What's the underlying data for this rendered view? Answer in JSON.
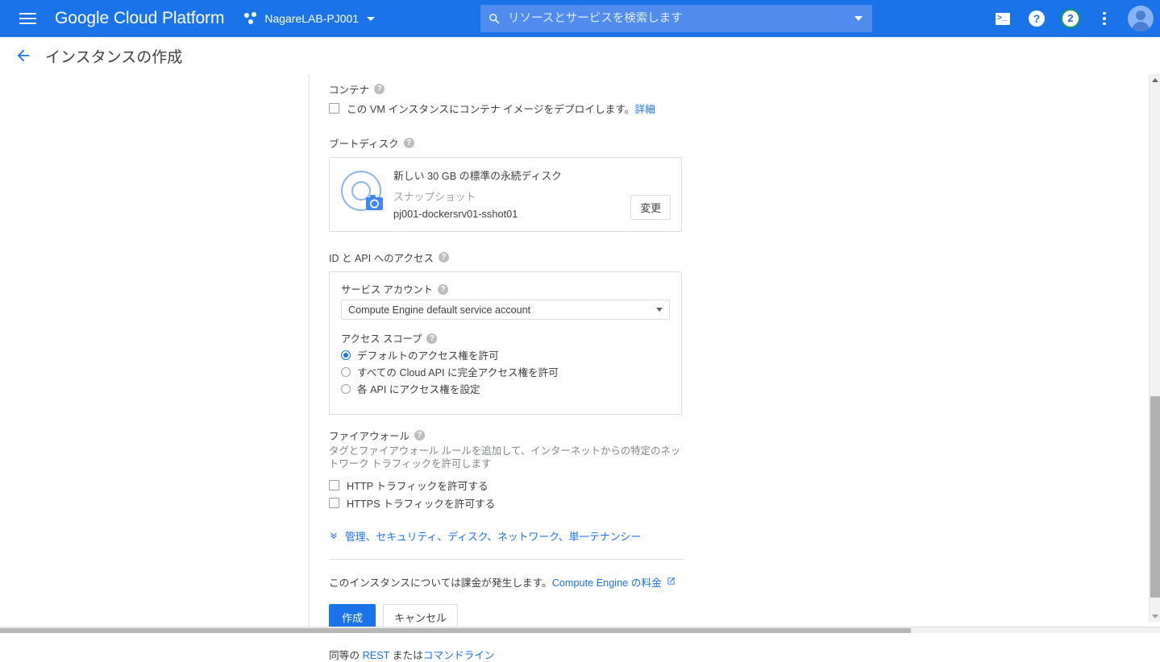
{
  "header": {
    "menu_icon": "hamburger-menu-icon",
    "brand": "Google Cloud Platform",
    "project": {
      "icon": "project-dots-icon",
      "name": "NagareLAB-PJ001",
      "caret": "chevron-down-icon"
    },
    "search": {
      "icon": "search-icon",
      "placeholder": "リソースとサービスを検索します",
      "value": "",
      "caret": "chevron-down-icon"
    },
    "actions": {
      "cloud_shell": ">_",
      "help": "?",
      "notifications_count": "2",
      "more_icon": "vertical-dots-icon",
      "avatar": "user-avatar"
    },
    "colors": {
      "header_blue": "#1a73e8",
      "search_blue": "#4f8ced",
      "notification_ring_green": "#0f9d58",
      "link_blue": "#1a73e8"
    }
  },
  "subheader": {
    "back_icon": "arrow-left-icon",
    "title": "インスタンスの作成"
  },
  "form": {
    "container": {
      "label": "コンテナ",
      "help": "?",
      "checkbox_label": "この VM インスタンスにコンテナ イメージをデプロイします。",
      "checkbox_checked": false,
      "detail_link": "詳細"
    },
    "boot_disk": {
      "label": "ブートディスク",
      "help": "?",
      "icon": "disk-snapshot-icon",
      "summary": "新しい 30 GB の標準の永続ディスク",
      "source_type": "スナップショット",
      "source_name": "pj001-dockersrv01-sshot01",
      "change_button": "変更"
    },
    "id_api": {
      "label": "ID と API へのアクセス",
      "help": "?",
      "service_account": {
        "label": "サービス アカウント",
        "help": "?",
        "value": "Compute Engine default service account",
        "caret": "chevron-down-icon"
      },
      "access_scope": {
        "label": "アクセス スコープ",
        "help": "?",
        "options": [
          {
            "label": "デフォルトのアクセス権を許可",
            "selected": true
          },
          {
            "label": "すべての Cloud API に完全アクセス権を許可",
            "selected": false
          },
          {
            "label": "各 API にアクセス権を設定",
            "selected": false
          }
        ]
      }
    },
    "firewall": {
      "label": "ファイアウォール",
      "help": "?",
      "description": "タグとファイアウォール ルールを追加して、インターネットからの特定のネットワーク トラフィックを許可します",
      "options": [
        {
          "label": "HTTP トラフィックを許可する",
          "checked": false
        },
        {
          "label": "HTTPS トラフィックを許可する",
          "checked": false
        }
      ]
    },
    "expander": {
      "chevron": "»",
      "label": "管理、セキュリティ、ディスク、ネットワーク、単一テナンシー"
    },
    "billing": {
      "text": "このインスタンスについては課金が発生します。",
      "link": "Compute Engine の料金",
      "external_icon": "external-link-icon"
    },
    "actions": {
      "create": "作成",
      "cancel": "キャンセル"
    },
    "equivalent": {
      "prefix": "同等の ",
      "rest_link": "REST",
      "middle": " または",
      "cli_link": "コマンドライン"
    }
  },
  "scrollbars": {
    "vertical_up_icon": "caret-up-icon",
    "vertical_down_icon": "caret-down-icon"
  }
}
